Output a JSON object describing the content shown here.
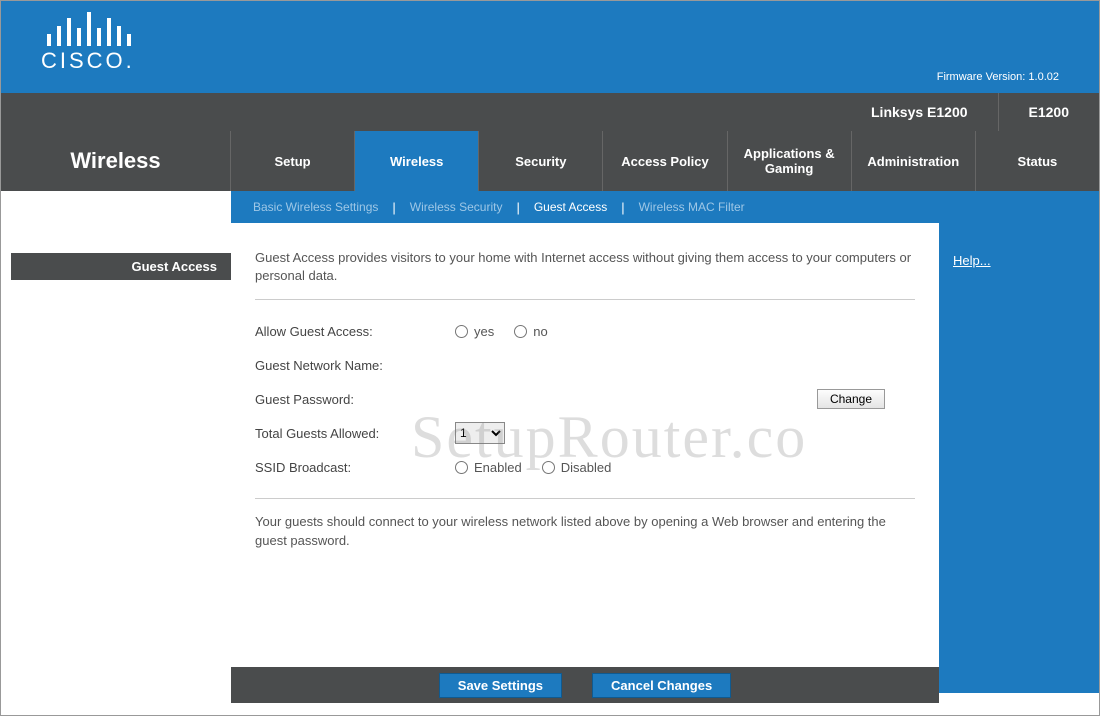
{
  "header": {
    "brand": "CISCO.",
    "firmware_label": "Firmware Version: 1.0.02"
  },
  "model": {
    "name": "Linksys E1200",
    "code": "E1200"
  },
  "page_title": "Wireless",
  "nav": {
    "items": [
      {
        "label": "Setup"
      },
      {
        "label": "Wireless"
      },
      {
        "label": "Security"
      },
      {
        "label": "Access Policy"
      },
      {
        "label": "Applications & Gaming"
      },
      {
        "label": "Administration"
      },
      {
        "label": "Status"
      }
    ],
    "active_index": 1
  },
  "subnav": {
    "items": [
      {
        "label": "Basic Wireless Settings"
      },
      {
        "label": "Wireless Security"
      },
      {
        "label": "Guest Access"
      },
      {
        "label": "Wireless MAC Filter"
      }
    ],
    "active_index": 2
  },
  "section_label": "Guest Access",
  "content": {
    "intro": "Guest Access provides visitors to your home with Internet access without giving them access to your computers or personal data.",
    "rows": {
      "allow_label": "Allow Guest Access:",
      "allow_yes": "yes",
      "allow_no": "no",
      "name_label": "Guest Network Name:",
      "name_value": "",
      "pass_label": "Guest Password:",
      "pass_value": "",
      "change_btn": "Change",
      "total_label": "Total Guests Allowed:",
      "total_value": "1",
      "ssid_label": "SSID Broadcast:",
      "ssid_enabled": "Enabled",
      "ssid_disabled": "Disabled"
    },
    "outro": "Your guests should connect to your wireless network listed above by opening a Web browser and entering the guest password."
  },
  "footer": {
    "save": "Save Settings",
    "cancel": "Cancel Changes"
  },
  "help_link": "Help...",
  "watermark": "SetupRouter.co"
}
